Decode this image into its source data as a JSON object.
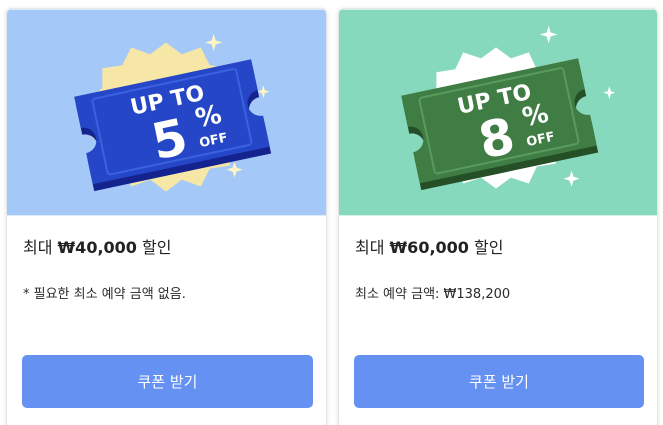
{
  "coupons": [
    {
      "badge": {
        "line1": "UP TO",
        "percent": "5",
        "sign": "%",
        "off": "OFF"
      },
      "title_prefix": "최대 ",
      "amount": "₩40,000",
      "title_suffix": " 할인",
      "note": "* 필요한 최소 예약 금액 없음.",
      "button_label": "쿠폰 받기",
      "colors": {
        "background": "#a4c8f7",
        "ticket": "#2547c7",
        "burst": "#f7e7a6"
      }
    },
    {
      "badge": {
        "line1": "UP TO",
        "percent": "8",
        "sign": "%",
        "off": "OFF"
      },
      "title_prefix": "최대 ",
      "amount": "₩60,000",
      "title_suffix": " 할인",
      "note": "최소 예약 금액: ₩138,200",
      "button_label": "쿠폰 받기",
      "colors": {
        "background": "#87d9bd",
        "ticket": "#3f7d44",
        "burst": "#ffffff"
      }
    }
  ]
}
